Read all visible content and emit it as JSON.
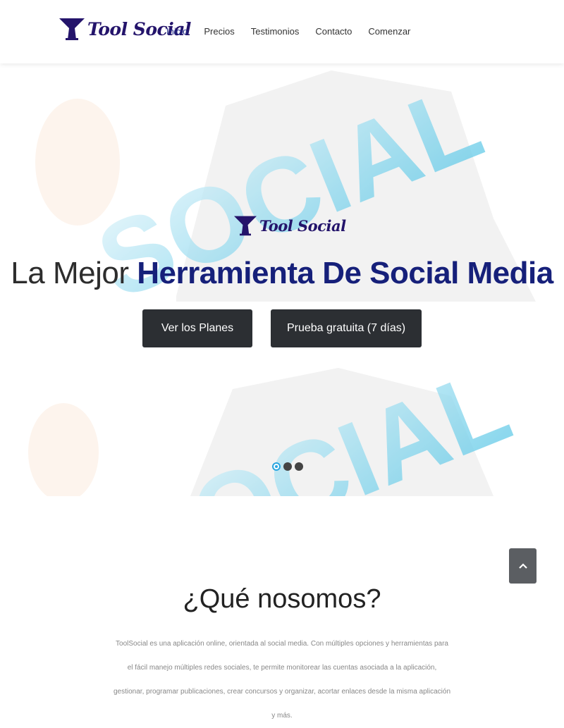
{
  "brand": {
    "name": "Tool Social",
    "color": "#24146b"
  },
  "nav": {
    "items": [
      {
        "label": "Inicio",
        "active": true
      },
      {
        "label": "Precios"
      },
      {
        "label": "Testimonios"
      },
      {
        "label": "Contacto"
      },
      {
        "label": "Comenzar"
      }
    ]
  },
  "hero": {
    "logo_text": "Tool Social",
    "background_text": "SOCIAL",
    "title_light": "La Mejor",
    "title_strong": "Herramienta De Social Media",
    "buttons": {
      "plans_label": "Ver los Planes",
      "trial_label": "Prueba gratuita (7 días)"
    },
    "slider": {
      "slides": 3,
      "active_index": 0
    }
  },
  "scroll_top": {
    "icon": "chevron-up-icon"
  },
  "about": {
    "title": "¿Qué nosomos?",
    "paragraph": "ToolSocial es una aplicación online, orientada al social media. Con múltiples opciones y herramientas para el fácil manejo múltiples redes sociales, te permite monitorear las cuentas asociada a la aplicación, gestionar, programar publicaciones, crear concursos y organizar, acortar enlaces desde la misma aplicación y más."
  },
  "colors": {
    "accent": "#16207a",
    "button_bg": "#2c2f33",
    "dot_active": "#2aa6e0",
    "scroll_top_bg": "#5b5e62"
  }
}
